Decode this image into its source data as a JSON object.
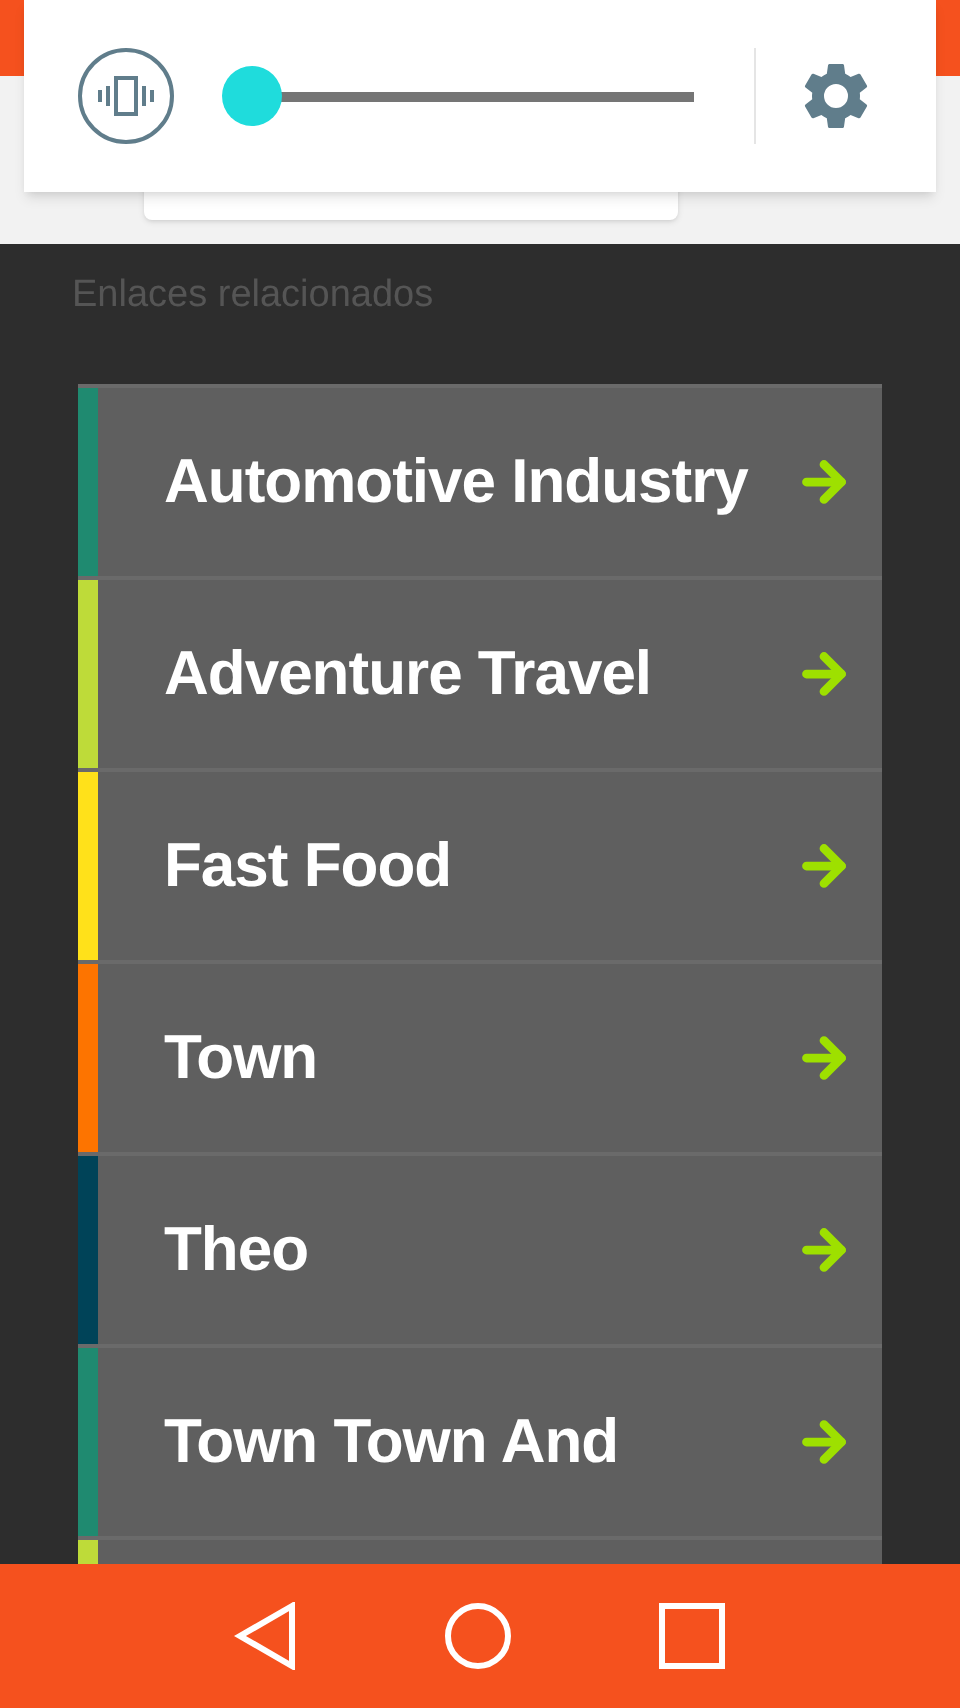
{
  "volume_panel": {
    "level": 0
  },
  "section_title": "Enlaces relacionados",
  "links": [
    {
      "label": "Automotive Industry",
      "color": "#1f8a70"
    },
    {
      "label": "Adventure Travel",
      "color": "#bedb39"
    },
    {
      "label": "Fast Food",
      "color": "#ffe11a"
    },
    {
      "label": "Town",
      "color": "#fd7400"
    },
    {
      "label": "Theo",
      "color": "#004358"
    },
    {
      "label": "Town Town And",
      "color": "#1f8a70"
    },
    {
      "color": "#bedb39"
    }
  ]
}
